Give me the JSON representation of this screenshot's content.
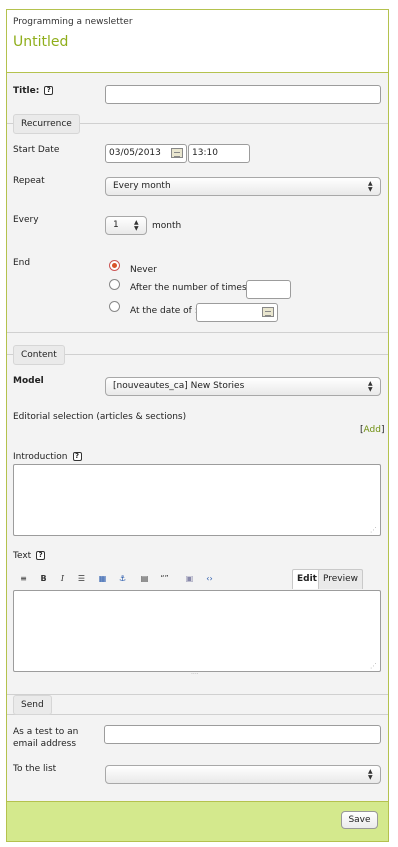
{
  "header": {
    "subtitle": "Programming a newsletter",
    "title": "Untitled"
  },
  "title_field": {
    "label": "Title:",
    "help": "?",
    "value": ""
  },
  "recurrence": {
    "legend": "Recurrence",
    "start_date_label": "Start Date",
    "start_date_value": "03/05/2013",
    "start_time_value": "13:10",
    "repeat_label": "Repeat",
    "repeat_value": "Every month",
    "every_label": "Every",
    "every_value": "1",
    "every_unit": "month",
    "end_label": "End",
    "end_never": "Never",
    "end_after": "After the number of times :",
    "end_at_date": "At the date of :"
  },
  "content": {
    "legend": "Content",
    "model_label": "Model",
    "model_value": "[nouveautes_ca] New Stories",
    "editorial_label": "Editorial selection (articles & sections)",
    "add_open": "[",
    "add_label": "Add",
    "add_close": "]",
    "intro_label": "Introduction",
    "text_label": "Text",
    "help": "?",
    "tab_edit": "Edit",
    "tab_preview": "Preview",
    "toolbar_icons": [
      "align-icon",
      "bold-icon",
      "italic-icon",
      "list-icon",
      "link-icon",
      "anchor-icon",
      "heading-icon",
      "quote-icon",
      "image-icon",
      "code-icon"
    ]
  },
  "send": {
    "legend": "Send",
    "test_label_1": "As a test to an",
    "test_label_2": "email address",
    "list_label": "To the list",
    "list_value": ""
  },
  "footer": {
    "save_label": "Save"
  },
  "colors": {
    "accent": "#8fae1b",
    "border": "#b4c24e",
    "footer_bg": "#d4e98d",
    "radio_on": "#d9532a"
  }
}
